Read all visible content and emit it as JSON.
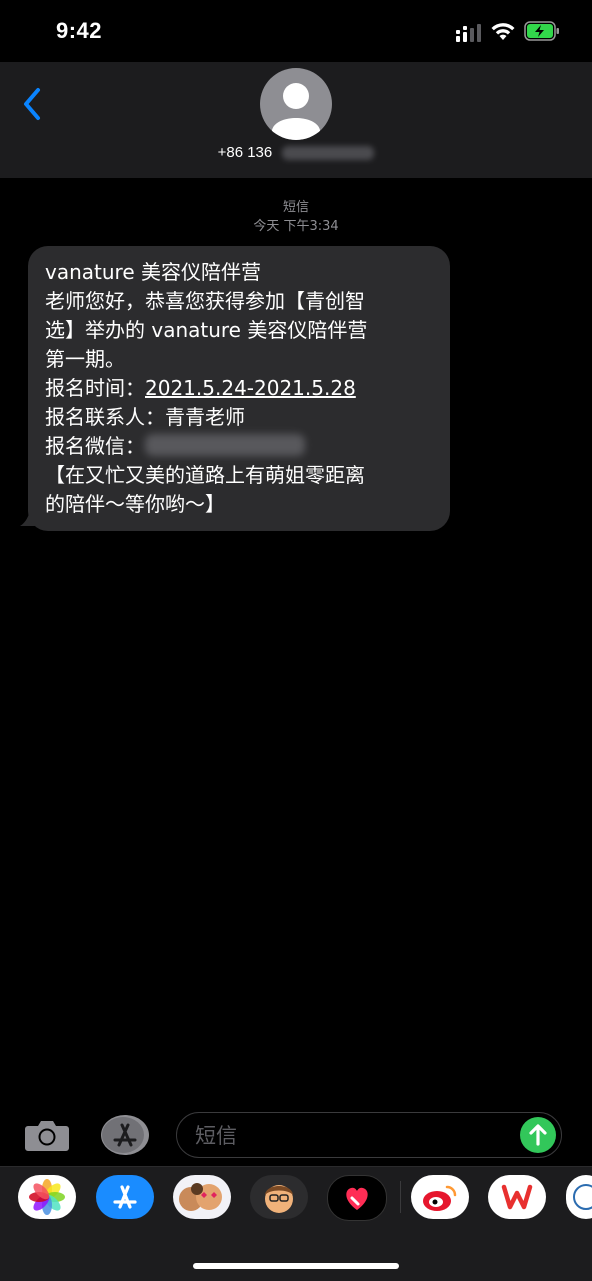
{
  "status_bar": {
    "time": "9:42"
  },
  "header": {
    "phone_prefix": "+86 136",
    "back_label": "Back"
  },
  "thread": {
    "service": "短信",
    "timestamp": "今天 下午3:34"
  },
  "message": {
    "lines": [
      "vanature 美容仪陪伴营",
      "老师您好，恭喜您获得参加【青创智",
      "选】举办的 vanature 美容仪陪伴营",
      "第一期。"
    ],
    "time_label": "报名时间：",
    "time_value": "2021.5.24-2021.5.28",
    "contact_line": "报名联系人：青青老师",
    "wechat_label": "报名微信：",
    "closing_1": "【在又忙又美的道路上有萌姐零距离",
    "closing_2": "的陪伴～等你哟～】"
  },
  "compose": {
    "placeholder": "短信"
  },
  "app_drawer": {
    "apps": [
      "photos-icon",
      "app-store-icon",
      "memoji-stickers-icon",
      "memoji-icon",
      "digital-touch-icon",
      "weibo-icon",
      "wps-office-icon",
      "partial-app-icon"
    ]
  },
  "colors": {
    "bubble": "#2c2c2e",
    "header": "#1c1c1e",
    "accent_blue": "#0a84ff",
    "send_green": "#32c75a",
    "battery_green": "#32d74b"
  }
}
